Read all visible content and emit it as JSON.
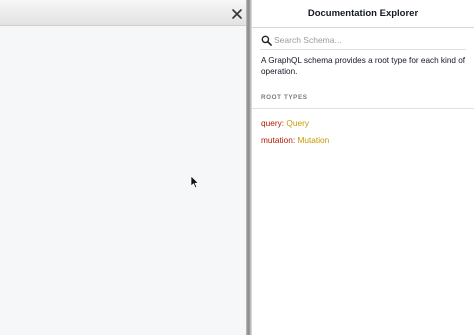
{
  "doc_explorer": {
    "title": "Documentation Explorer",
    "search_placeholder": "Search Schema...",
    "description": "A GraphQL schema provides a root type for each kind of operation.",
    "section_title": "ROOT TYPES",
    "root_types": [
      {
        "field": "query",
        "separator": ": ",
        "type": "Query"
      },
      {
        "field": "mutation",
        "separator": ": ",
        "type": "Mutation"
      }
    ]
  },
  "icons": {
    "close": "close-icon",
    "search": "search-icon",
    "cursor": "mouse-cursor-icon"
  },
  "colors": {
    "field_name": "#b11a04",
    "type_name": "#ca9800"
  }
}
